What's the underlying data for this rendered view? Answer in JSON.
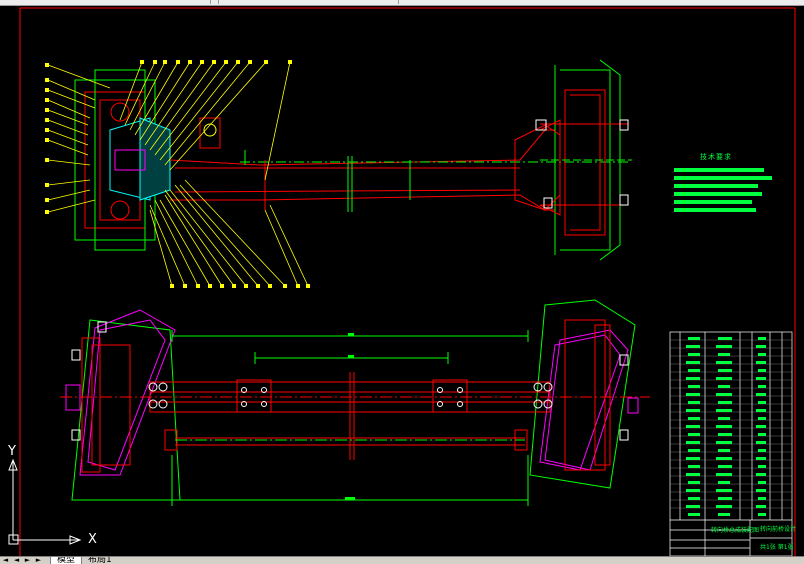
{
  "window": {
    "top_strip": "window-chrome"
  },
  "drawing": {
    "technical_requirements_title": "技术要求",
    "title_block": {
      "name_text": "转向桥总成装配图",
      "drawing_no": "转向前桥设计",
      "sheet_info": "共1张 第1张"
    },
    "ucs": {
      "x_label": "X",
      "y_label": "Y"
    }
  },
  "tabs": {
    "nav_first": "◄",
    "nav_prev": "◄",
    "nav_next": "►",
    "nav_last": "►",
    "model_tab": "模型",
    "layout_tab": "布局1"
  },
  "colors": {
    "background": "#000000",
    "frame_red": "#ff0000",
    "outline_green": "#00ff00",
    "leader_yellow": "#ffff00",
    "cyan": "#00ffff",
    "magenta": "#ff00ff"
  }
}
